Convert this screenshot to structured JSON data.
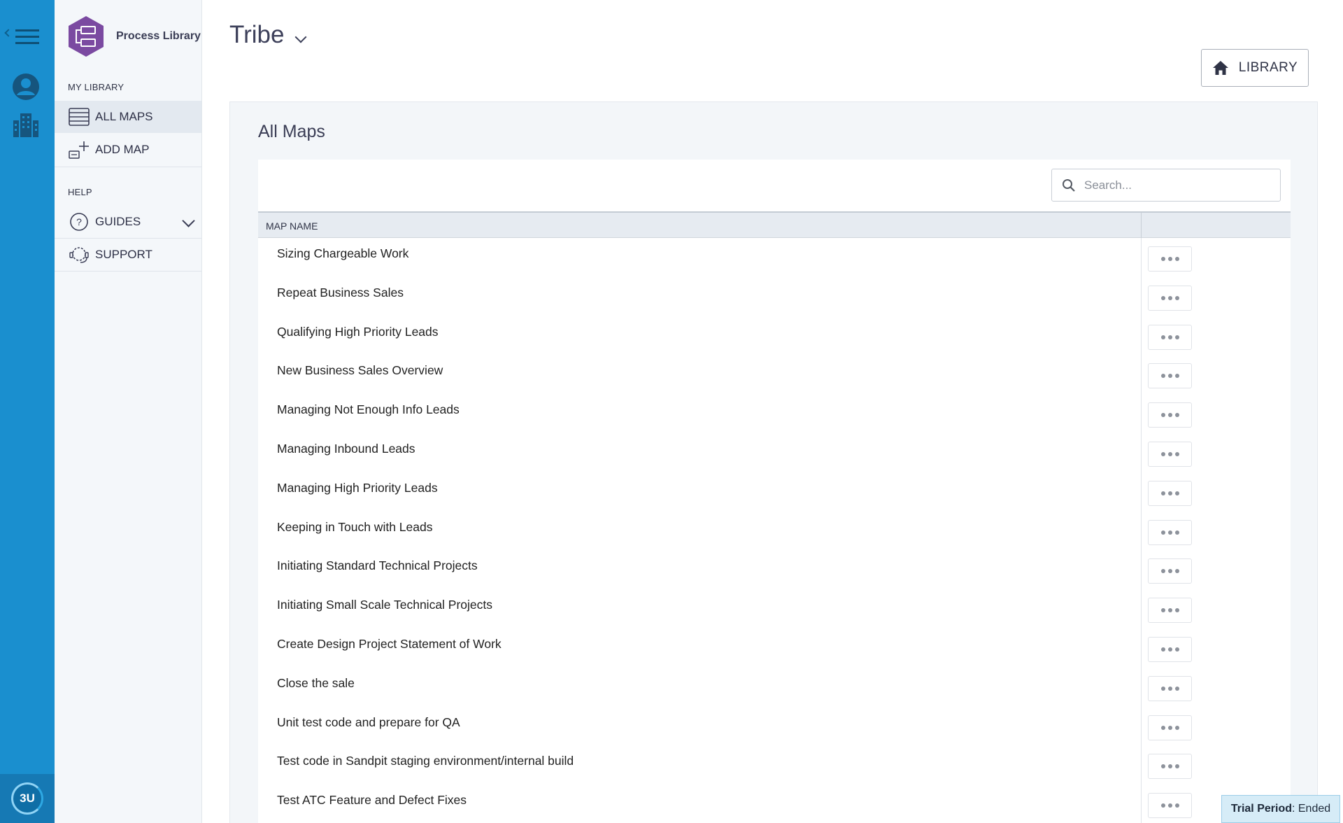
{
  "app": {
    "name": "Process Library",
    "logo_text": "3U"
  },
  "sidebar": {
    "sections": [
      {
        "label": "MY LIBRARY"
      },
      {
        "label": "HELP"
      }
    ],
    "items": [
      {
        "label": "ALL MAPS",
        "icon": "list-icon"
      },
      {
        "label": "ADD MAP",
        "icon": "add-map-icon"
      },
      {
        "label": "GUIDES",
        "icon": "question-icon"
      },
      {
        "label": "SUPPORT",
        "icon": "headset-icon"
      }
    ]
  },
  "header": {
    "title": "Tribe",
    "library_button": "LIBRARY"
  },
  "panel": {
    "title": "All Maps",
    "search": {
      "placeholder": "Search...",
      "value": ""
    },
    "columns": [
      "MAP NAME",
      ""
    ],
    "rows": [
      "Sizing Chargeable Work",
      "Repeat Business Sales",
      "Qualifying High Priority Leads",
      "New Business Sales Overview",
      "Managing Not Enough Info Leads",
      "Managing Inbound Leads",
      "Managing High Priority Leads",
      "Keeping in Touch with Leads",
      "Initiating Standard Technical Projects",
      "Initiating Small Scale Technical Projects",
      "Create Design Project Statement of Work",
      "Close the sale",
      "Unit test code and prepare for QA",
      "Test code in Sandpit staging environment/internal build",
      "Test ATC Feature and Defect Fixes"
    ]
  },
  "trial": {
    "label": "Trial Period",
    "status": ": Ended"
  },
  "colors": {
    "rail": "#1a8fcf",
    "brand": "#7b4aa1",
    "sidebar": "#f4f7fa"
  }
}
